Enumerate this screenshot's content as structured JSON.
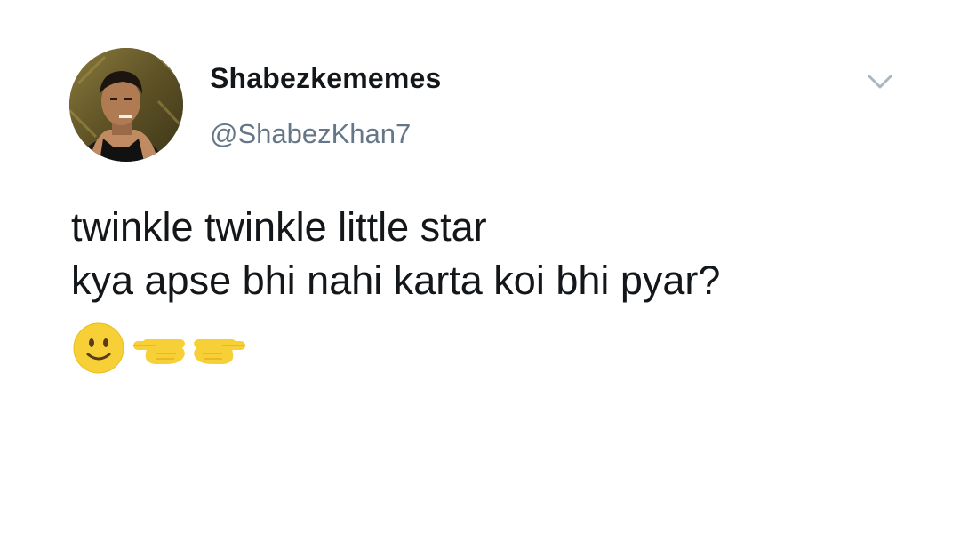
{
  "tweet": {
    "display_name": "Shabezkememes",
    "handle": "@ShabezKhan7",
    "text_lines": [
      "twinkle twinkle little star",
      "kya apse bhi nahi karta koi bhi pyar?"
    ],
    "emojis": [
      "slightly-smiling-face-icon",
      "backhand-index-pointing-left-icon",
      "backhand-index-pointing-right-icon"
    ]
  },
  "colors": {
    "name": "#14171a",
    "handle": "#657786",
    "caret": "#aab8c2",
    "emoji_yellow": "#f7d038"
  }
}
